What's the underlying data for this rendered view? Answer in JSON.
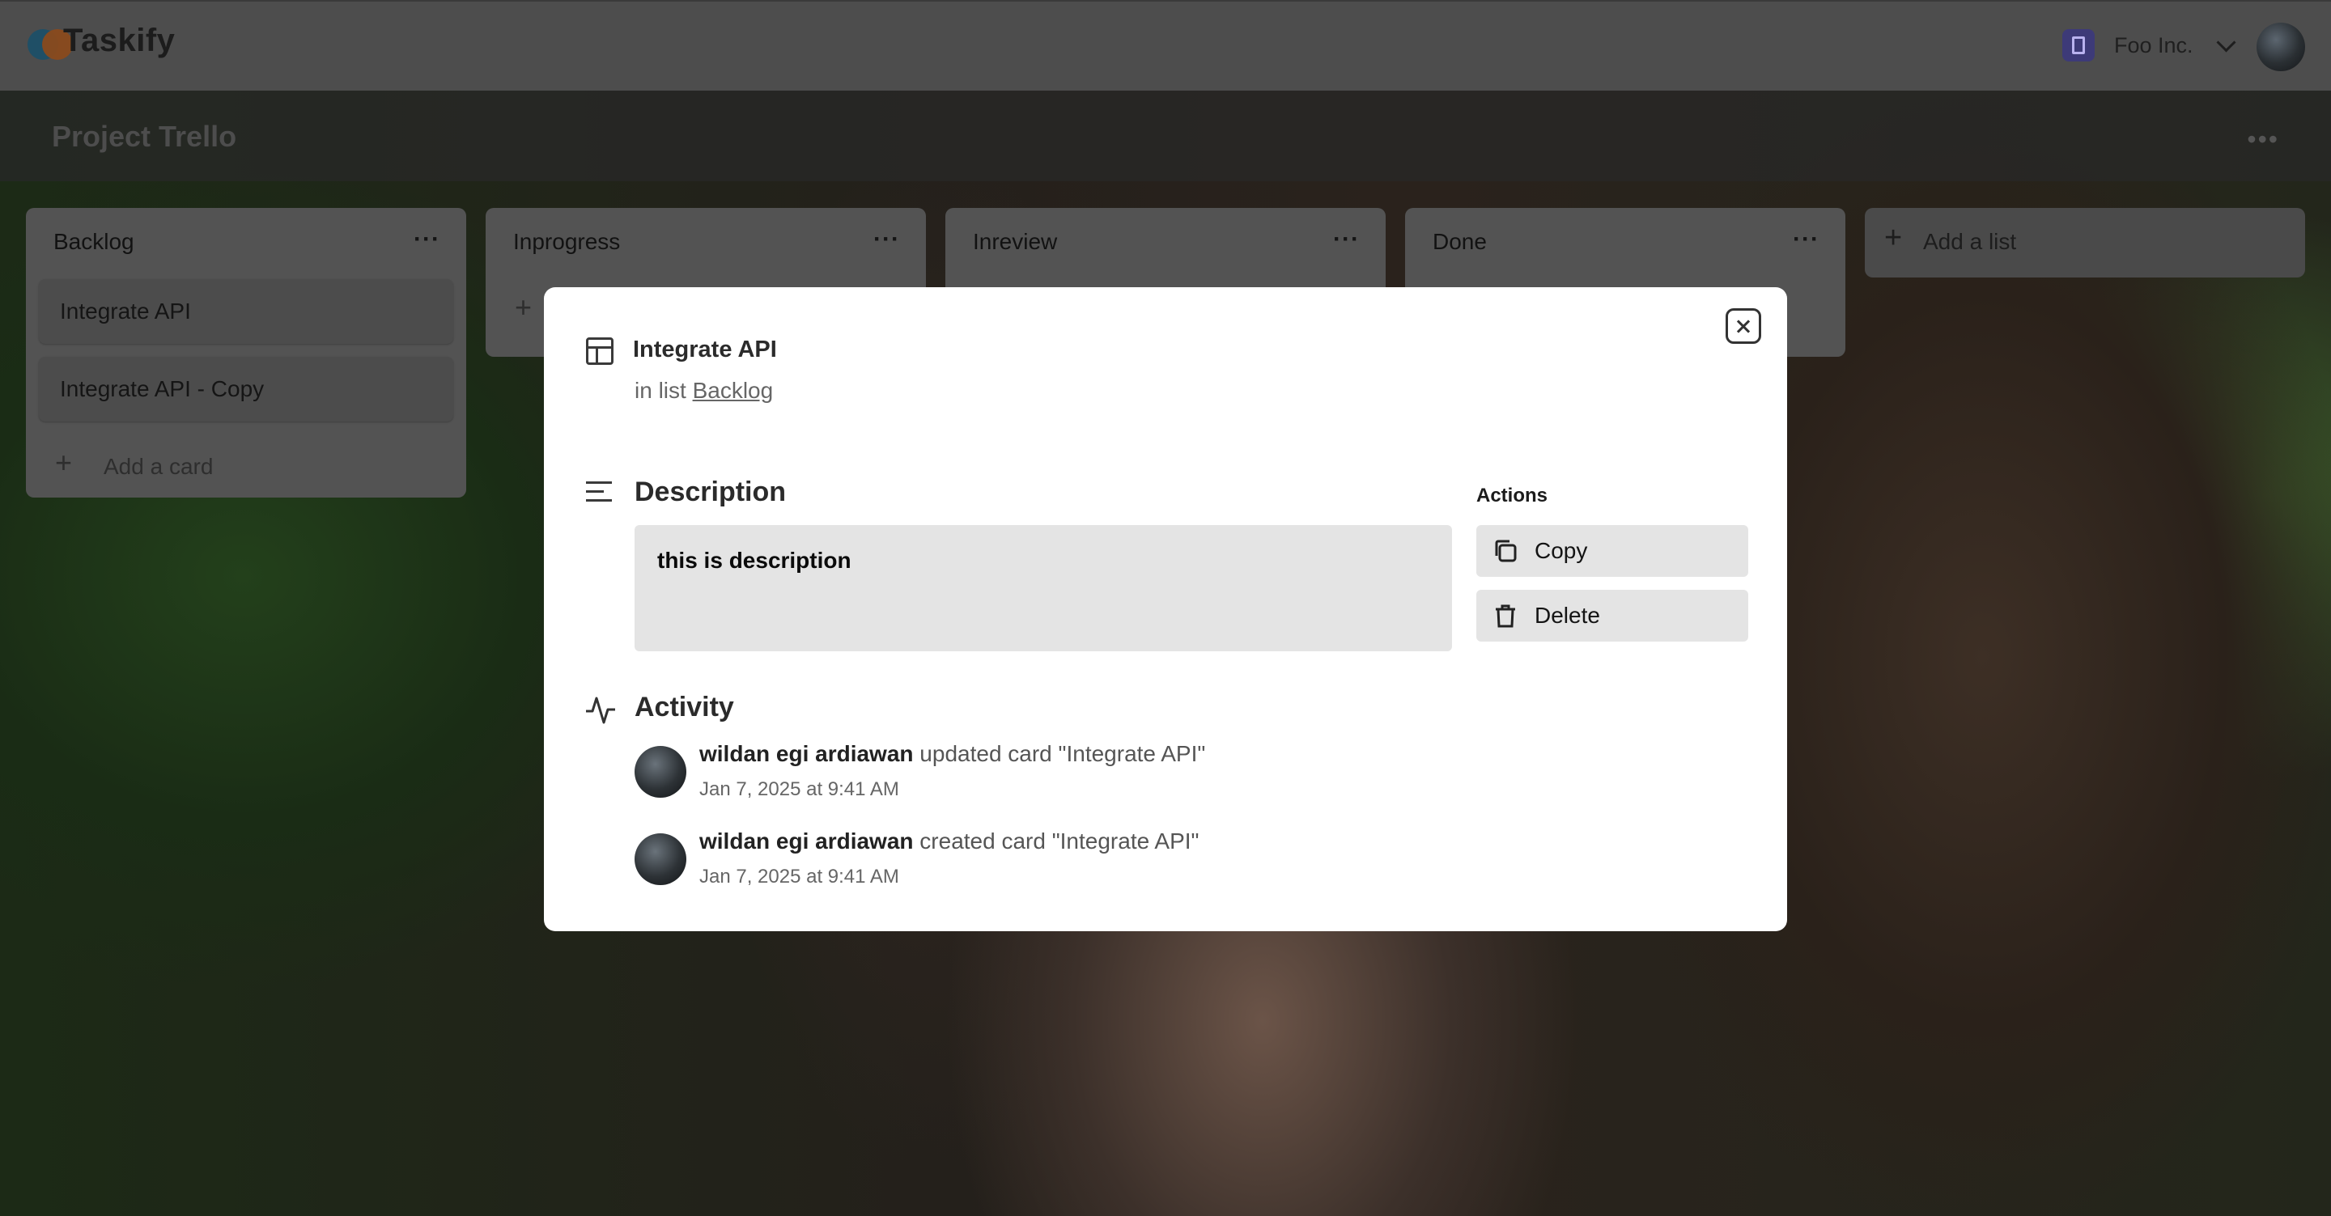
{
  "navbar": {
    "app_name": "Taskify",
    "org_name": "Foo Inc."
  },
  "board": {
    "title": "Project Trello"
  },
  "lists": [
    {
      "title": "Backlog",
      "cards": [
        "Integrate API",
        "Integrate API - Copy"
      ],
      "add_card_label": "Add a card"
    },
    {
      "title": "Inprogress"
    },
    {
      "title": "Inreview"
    },
    {
      "title": "Done"
    }
  ],
  "add_list_label": "Add a list",
  "modal": {
    "card_title": "Integrate API",
    "in_list_prefix": "in list",
    "list_name": "Backlog",
    "description_heading": "Description",
    "description_text": "this is description",
    "actions_heading": "Actions",
    "copy_label": "Copy",
    "delete_label": "Delete",
    "activity_heading": "Activity",
    "activity": [
      {
        "user": "wildan egi ardiawan",
        "action": "updated card \"Integrate API\"",
        "time": "Jan 7, 2025 at 9:41 AM"
      },
      {
        "user": "wildan egi ardiawan",
        "action": "created card \"Integrate API\"",
        "time": "Jan 7, 2025 at 9:41 AM"
      }
    ]
  },
  "icons": {
    "logo": "taskify-logo-icon",
    "org": "organization-icon",
    "chevron": "chevron-down-icon",
    "more": "more-dots-icon",
    "plus": "plus-icon",
    "close": "close-icon",
    "card": "layout-icon",
    "description": "align-left-icon",
    "copy": "copy-icon",
    "delete": "trash-icon",
    "activity": "activity-icon"
  }
}
